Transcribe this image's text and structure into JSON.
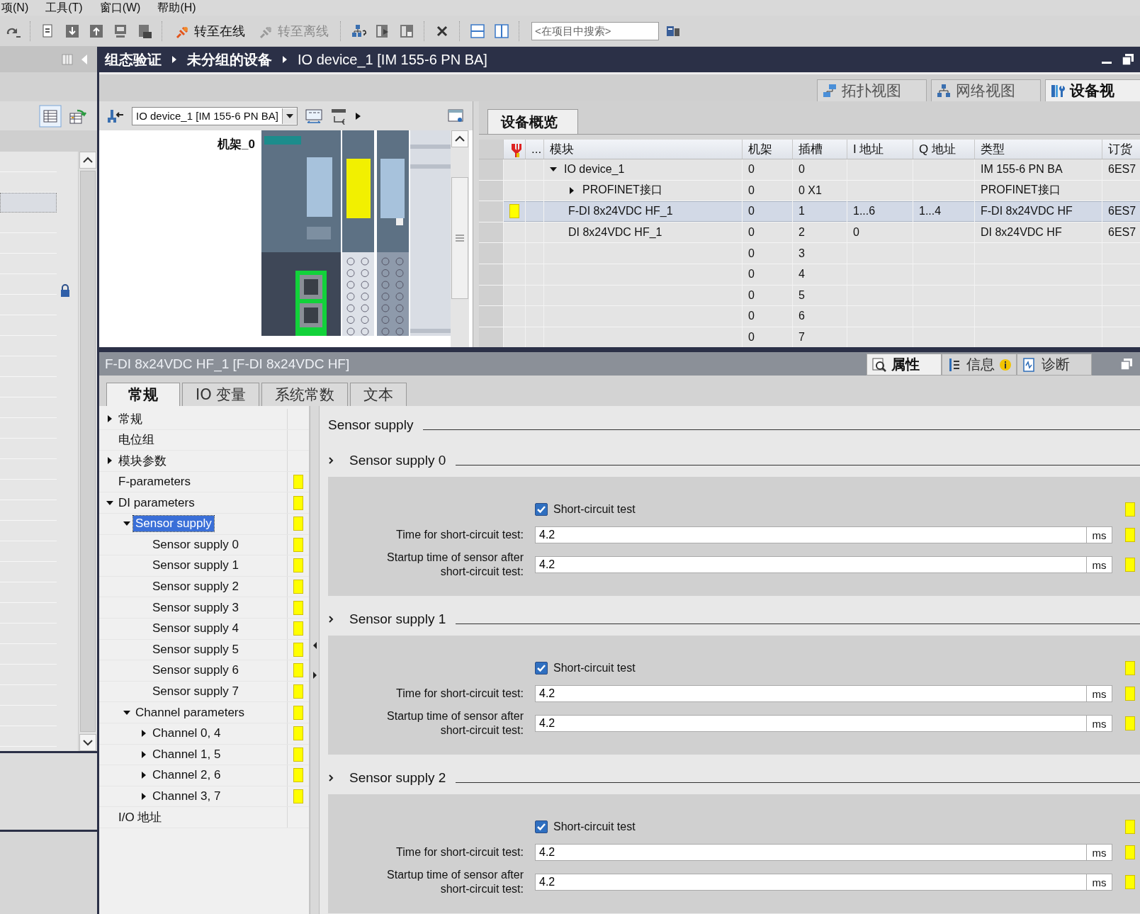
{
  "menu": [
    "项(N)",
    "工具(T)",
    "窗口(W)",
    "帮助(H)"
  ],
  "toolbar": {
    "go_online": {
      "label": "转至在线",
      "disabled": false
    },
    "go_offline": {
      "label": "转至离线",
      "disabled": true
    },
    "search": {
      "placeholder": "<在项目中搜索>"
    }
  },
  "breadcrumb": [
    "组态验证",
    "未分组的设备",
    "IO device_1 [IM 155-6 PN BA]"
  ],
  "view_tabs": [
    {
      "label": "拓扑视图",
      "selected": false
    },
    {
      "label": "网络视图",
      "selected": false
    },
    {
      "label": "设备视",
      "selected": true
    }
  ],
  "device_view": {
    "device_select": "IO device_1 [IM 155-6 PN BA]",
    "rack_label": "机架_0"
  },
  "overview": {
    "tab": "设备概览",
    "columns": [
      "...",
      "模块",
      "机架",
      "插槽",
      "I 地址",
      "Q 地址",
      "类型",
      "订货"
    ],
    "rows": [
      {
        "module": "IO device_1",
        "expanded": true,
        "rack": "0",
        "slot": "0",
        "type": "IM 155-6 PN BA",
        "order": "6ES7",
        "selected": false,
        "modified": false,
        "children": [
          {
            "module": "PROFINET接口",
            "expanded": false,
            "rack": "0",
            "slot": "0 X1",
            "type": "PROFINET接口",
            "selected": false,
            "modified": false
          },
          {
            "module": "F-DI 8x24VDC HF_1",
            "rack": "0",
            "slot": "1",
            "i_addr": "1...6",
            "q_addr": "1...4",
            "type": "F-DI 8x24VDC HF",
            "order": "6ES7",
            "selected": true,
            "modified": true
          },
          {
            "module": "DI 8x24VDC HF_1",
            "rack": "0",
            "slot": "2",
            "i_addr": "0",
            "type": "DI 8x24VDC HF",
            "order": "6ES7",
            "selected": false,
            "modified": false
          }
        ]
      },
      {
        "rack": "0",
        "slot": "3",
        "selected": false,
        "modified": false
      },
      {
        "rack": "0",
        "slot": "4",
        "selected": false,
        "modified": false
      },
      {
        "rack": "0",
        "slot": "5",
        "selected": false,
        "modified": false
      },
      {
        "rack": "0",
        "slot": "6",
        "selected": false,
        "modified": false
      },
      {
        "rack": "0",
        "slot": "7",
        "selected": false,
        "modified": false
      }
    ]
  },
  "inspector": {
    "title": "F-DI 8x24VDC HF_1 [F-DI 8x24VDC HF]",
    "side_tabs": [
      {
        "label": "属性",
        "selected": true
      },
      {
        "label": "信息",
        "selected": false
      },
      {
        "label": "诊断",
        "selected": false
      }
    ],
    "tabs": [
      {
        "label": "常规",
        "selected": true
      },
      {
        "label": "IO 变量",
        "selected": false
      },
      {
        "label": "系统常数",
        "selected": false
      },
      {
        "label": "文本",
        "selected": false
      }
    ],
    "tree": [
      {
        "label": "常规",
        "expanded": false,
        "selected": false,
        "modified": false
      },
      {
        "label": "电位组",
        "selected": false,
        "modified": false
      },
      {
        "label": "模块参数",
        "expanded": false,
        "selected": false,
        "modified": false
      },
      {
        "label": "F-parameters",
        "selected": false,
        "modified": true
      },
      {
        "label": "DI parameters",
        "expanded": true,
        "selected": false,
        "modified": true,
        "children": [
          {
            "label": "Sensor supply",
            "expanded": true,
            "selected": true,
            "modified": true,
            "children": [
              {
                "label": "Sensor supply 0",
                "selected": false,
                "modified": true
              },
              {
                "label": "Sensor supply 1",
                "selected": false,
                "modified": true
              },
              {
                "label": "Sensor supply 2",
                "selected": false,
                "modified": true
              },
              {
                "label": "Sensor supply 3",
                "selected": false,
                "modified": true
              },
              {
                "label": "Sensor supply 4",
                "selected": false,
                "modified": true
              },
              {
                "label": "Sensor supply 5",
                "selected": false,
                "modified": true
              },
              {
                "label": "Sensor supply 6",
                "selected": false,
                "modified": true
              },
              {
                "label": "Sensor supply 7",
                "selected": false,
                "modified": true
              }
            ]
          },
          {
            "label": "Channel parameters",
            "expanded": true,
            "selected": false,
            "modified": true,
            "children": [
              {
                "label": "Channel 0, 4",
                "expanded": false,
                "selected": false,
                "modified": true
              },
              {
                "label": "Channel 1, 5",
                "expanded": false,
                "selected": false,
                "modified": true
              },
              {
                "label": "Channel 2, 6",
                "expanded": false,
                "selected": false,
                "modified": true
              },
              {
                "label": "Channel 3, 7",
                "expanded": false,
                "selected": false,
                "modified": true
              }
            ]
          }
        ]
      },
      {
        "label": "I/O 地址",
        "selected": false,
        "modified": false
      }
    ],
    "content": {
      "heading": "Sensor supply",
      "sections": [
        {
          "title": "Sensor supply 0",
          "checkbox": {
            "label": "Short-circuit test",
            "checked": true,
            "modified": true
          },
          "fields": [
            {
              "label": "Time for short-circuit test:",
              "value": "4.2",
              "unit": "ms",
              "modified": true
            },
            {
              "label": "Startup time of sensor after short-circuit test:",
              "value": "4.2",
              "unit": "ms",
              "modified": true
            }
          ]
        },
        {
          "title": "Sensor supply 1",
          "checkbox": {
            "label": "Short-circuit test",
            "checked": true,
            "modified": true
          },
          "fields": [
            {
              "label": "Time for short-circuit test:",
              "value": "4.2",
              "unit": "ms",
              "modified": true
            },
            {
              "label": "Startup time of sensor after short-circuit test:",
              "value": "4.2",
              "unit": "ms",
              "modified": true
            }
          ]
        },
        {
          "title": "Sensor supply 2",
          "checkbox": {
            "label": "Short-circuit test",
            "checked": true,
            "modified": true
          },
          "fields": [
            {
              "label": "Time for short-circuit test:",
              "value": "4.2",
              "unit": "ms",
              "modified": true
            },
            {
              "label": "Startup time of sensor after short-circuit test:",
              "value": "4.2",
              "unit": "ms",
              "modified": true
            }
          ]
        }
      ]
    }
  }
}
